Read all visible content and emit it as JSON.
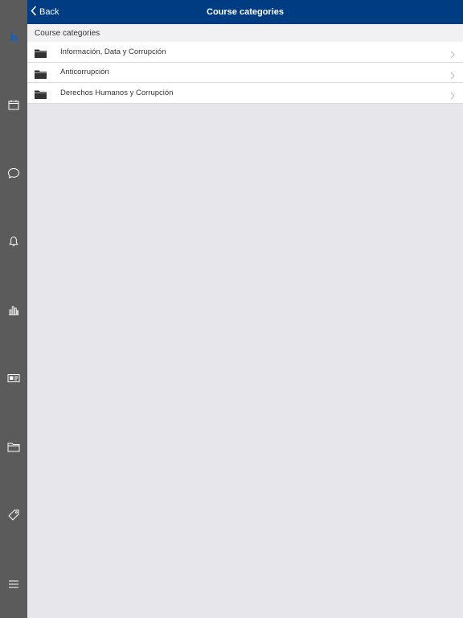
{
  "header": {
    "back_label": "Back",
    "title": "Course categories"
  },
  "sidebar": {
    "items": [
      {
        "icon": "home-icon"
      },
      {
        "icon": "calendar-icon"
      },
      {
        "icon": "chat-icon"
      },
      {
        "icon": "bell-icon"
      },
      {
        "icon": "bar-chart-icon"
      },
      {
        "icon": "id-card-icon"
      },
      {
        "icon": "folder-icon"
      },
      {
        "icon": "tag-icon"
      },
      {
        "icon": "menu-icon"
      }
    ]
  },
  "main": {
    "section_title": "Course categories",
    "categories": [
      {
        "label": "Información, Data y Corrupción"
      },
      {
        "label": "Anticorrupción"
      },
      {
        "label": "Derechos Humanos y Corrupción"
      }
    ]
  },
  "colors": {
    "header_bg": "#003c82",
    "sidebar_bg": "#5b5b5c",
    "accent": "#1f5fb0",
    "background": "#e7e6ea"
  }
}
